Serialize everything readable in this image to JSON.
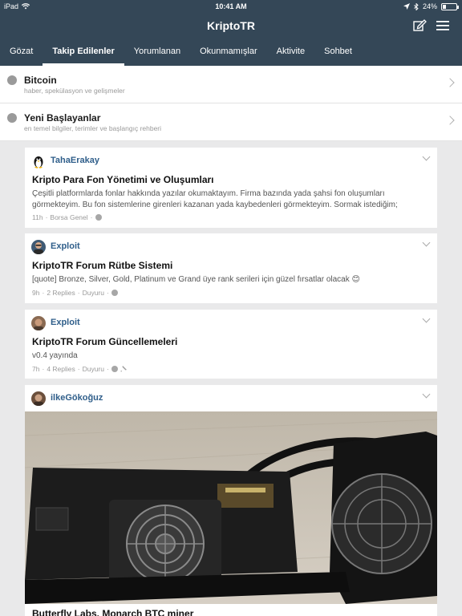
{
  "status_bar": {
    "device": "iPad",
    "time": "10:41 AM",
    "battery": "24%",
    "battery_level": 0.24
  },
  "app": {
    "title": "KriptoTR"
  },
  "tabs": [
    {
      "label": "Gözat"
    },
    {
      "label": "Takip Edilenler",
      "active": true
    },
    {
      "label": "Yorumlanan"
    },
    {
      "label": "Okunmamışlar"
    },
    {
      "label": "Aktivite"
    },
    {
      "label": "Sohbet"
    }
  ],
  "categories": [
    {
      "title": "Bitcoin",
      "description": "haber, spekülasyon ve gelişmeler"
    },
    {
      "title": "Yeni Başlayanlar",
      "description": "en temel bilgiler, terimler ve başlangıç rehberi"
    }
  ],
  "posts": [
    {
      "author": "TahaErakay",
      "title": "Kripto Para Fon Yönetimi ve Oluşumları",
      "body": "Çeşitli platformlarda fonlar hakkında yazılar okumaktayım. Firma bazında yada şahsi fon oluşumları görmekteyim. Bu fon sistemlerine girenleri kazanan yada kaybedenleri görmekteyim. Sormak istediğim;",
      "meta_time": "11h",
      "meta_forum": "Borsa Genel"
    },
    {
      "author": "Exploit",
      "title": "KriptoTR Forum Rütbe Sistemi",
      "body": "[quote] Bronze, Silver, Gold, Platinum ve Grand üye rank serileri için güzel fırsatlar olacak 😊",
      "meta_time": "9h",
      "meta_replies": "2 Replies",
      "meta_forum": "Duyuru"
    },
    {
      "author": "Exploit",
      "title": "KriptoTR Forum Güncellemeleri",
      "body": "v0.4 yayında",
      "meta_time": "7h",
      "meta_replies": "4 Replies",
      "meta_forum": "Duyuru"
    },
    {
      "author": "ilkeGökoğuz",
      "photo_caption": "Butterfly Labs. Monarch BTC miner"
    }
  ],
  "icons": {
    "wifi": "wifi-icon",
    "location": "location-icon",
    "bluetooth": "bluetooth-icon",
    "compose": "compose-icon",
    "menu": "menu-icon",
    "check": "check-icon",
    "chevron": "chevron-right-icon",
    "pin": "pin-icon"
  },
  "colors": {
    "header": "#344757",
    "author": "#2f5e8a",
    "background": "#e9e9ea"
  }
}
